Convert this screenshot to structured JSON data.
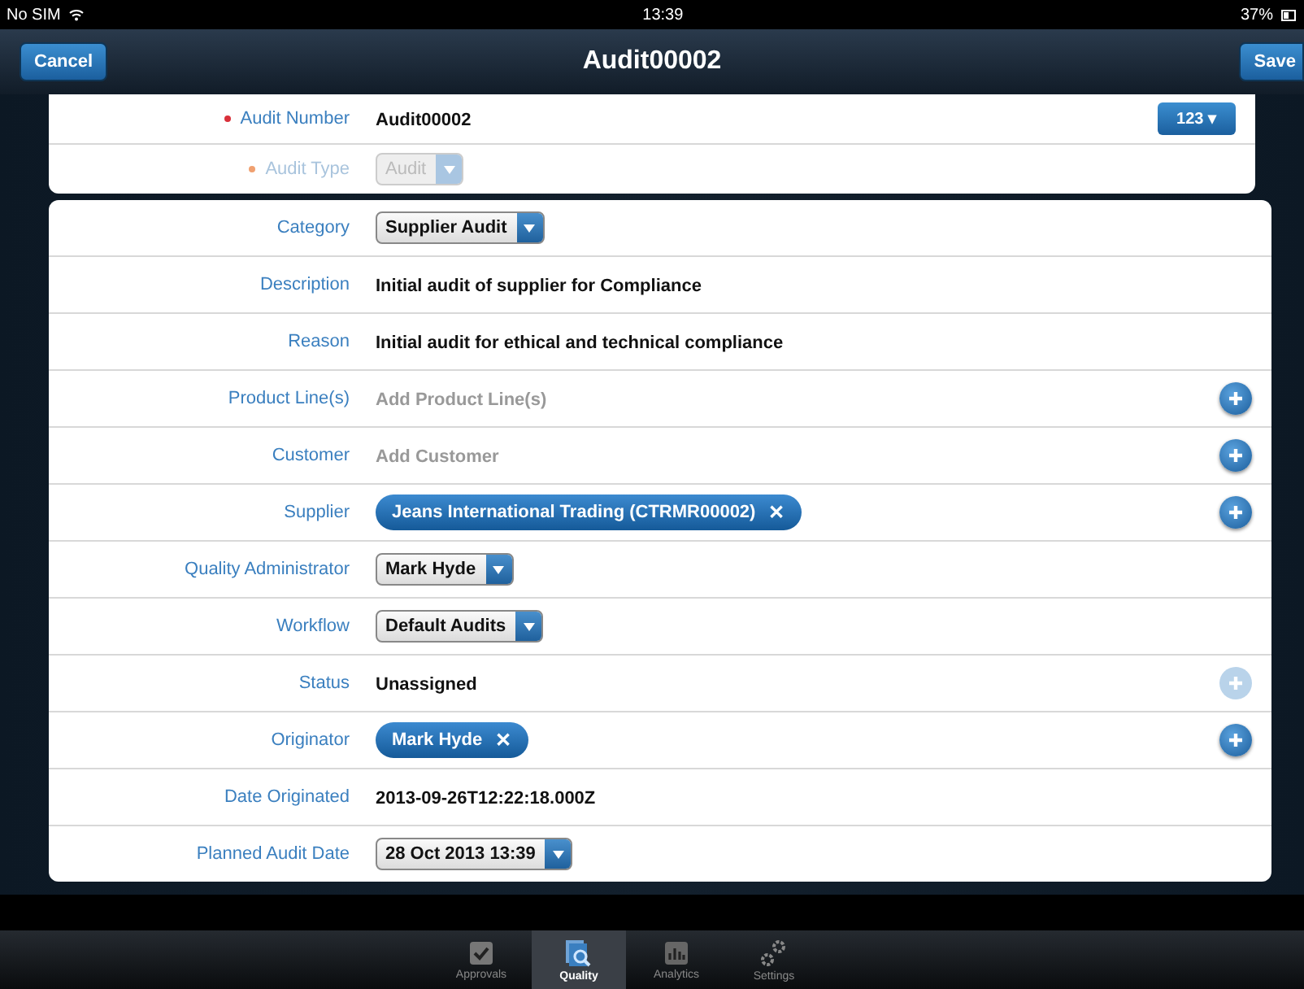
{
  "status_bar": {
    "carrier": "No SIM",
    "time": "13:39",
    "battery": "37%"
  },
  "nav_bar": {
    "cancel": "Cancel",
    "title": "Audit00002",
    "save": "Save"
  },
  "header_fields": [
    {
      "label": "Audit Number",
      "required": true,
      "kind": "text",
      "value": "Audit00002",
      "keypad": "123 ▾"
    },
    {
      "label": "Audit Type",
      "required": true,
      "kind": "select",
      "value": "Audit",
      "disabled": true
    }
  ],
  "fields": [
    {
      "label": "Category",
      "kind": "select",
      "value": "Supplier Audit"
    },
    {
      "label": "Description",
      "kind": "text",
      "value": "Initial audit of supplier for Compliance"
    },
    {
      "label": "Reason",
      "kind": "text",
      "value": "Initial audit for ethical and technical compliance"
    },
    {
      "label": "Product Line(s)",
      "kind": "input",
      "placeholder": "Add Product Line(s)",
      "add_button": {
        "disabled": false
      }
    },
    {
      "label": "Customer",
      "kind": "input",
      "placeholder": "Add Customer",
      "add_button": {
        "disabled": false
      }
    },
    {
      "label": "Supplier",
      "kind": "token",
      "value": "Jeans International Trading (CTRMR00002)",
      "remove": "✕",
      "add_button": {
        "disabled": false
      }
    },
    {
      "label": "Quality Administrator",
      "kind": "select",
      "value": "Mark Hyde"
    },
    {
      "label": "Workflow",
      "kind": "select",
      "value": "Default Audits"
    },
    {
      "label": "Status",
      "kind": "text",
      "value": "Unassigned",
      "add_button": {
        "disabled": true
      }
    },
    {
      "label": "Originator",
      "kind": "token",
      "value": "Mark Hyde",
      "remove": "✕",
      "add_button": {
        "disabled": false
      }
    },
    {
      "label": "Date Originated",
      "kind": "text",
      "value": "2013-09-26T12:22:18.000Z"
    },
    {
      "label": "Planned Audit Date",
      "kind": "select",
      "value": "28 Oct 2013 13:39"
    }
  ],
  "tab_bar": [
    {
      "label": "Approvals",
      "selected": false
    },
    {
      "label": "Quality",
      "selected": true
    },
    {
      "label": "Analytics",
      "selected": false
    },
    {
      "label": "Settings",
      "selected": false
    }
  ]
}
